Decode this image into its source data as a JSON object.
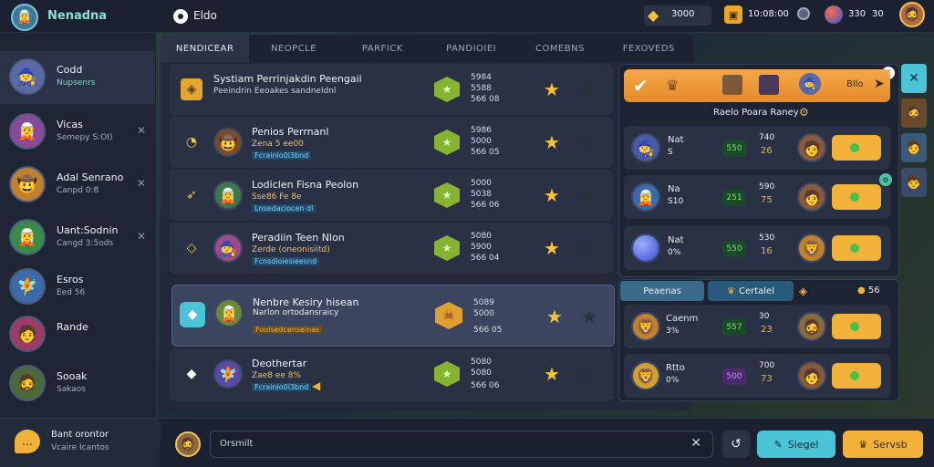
{
  "app": {
    "title": "Nenadna"
  },
  "header": {
    "page_title": "Eldo",
    "currencies": [
      {
        "icon": "gem-icon",
        "value": "3000"
      },
      {
        "icon": "coin-icon",
        "value": "10:08:00"
      },
      {
        "icon": "shield-icon",
        "value": "330"
      },
      {
        "icon": "stopwatch-icon",
        "value": "30"
      }
    ]
  },
  "tabs": [
    "NENDICEAR",
    "NEOPCLE",
    "PARFICK",
    "PANDIOIEI",
    "COMEBNS",
    "FEXOVEDS"
  ],
  "sidebar": {
    "items": [
      {
        "name": "Codd",
        "sub": "Nupsenrs"
      },
      {
        "name": "Vicas",
        "sub": "Semepy S:OI)"
      },
      {
        "name": "Adal Senrano",
        "sub": "Canpd 0:8"
      },
      {
        "name": "Uant:Sodnin",
        "sub": "Cangd 3:5ods"
      },
      {
        "name": "Esros",
        "sub": "Eed 56"
      },
      {
        "name": "Rande",
        "sub": ""
      },
      {
        "name": "Sooak",
        "sub": "Sakaos"
      }
    ],
    "footer": {
      "line1": "Bant orontor",
      "line2": "Vcaire Icantos"
    }
  },
  "rows": [
    {
      "name": "Systiam Perrinjakdin Peengaii",
      "sub": "Peeindrin Eeoakes sandneldnl",
      "tag": "",
      "stat1": "5984",
      "stat2": "5588",
      "stat3": "566 08"
    },
    {
      "name": "Penios Perrnanl",
      "sub": "Zena 5 ee00",
      "tag": "Fcrainlo0l3bnd",
      "stat1": "5986",
      "stat2": "5000",
      "stat3": "566 05"
    },
    {
      "name": "Lodiclen Fisna Peolon",
      "sub": "Sse86 Fe 8e",
      "tag": "Lnsedaciocen dl",
      "stat1": "5000",
      "stat2": "5038",
      "stat3": "566 06"
    },
    {
      "name": "Peradiin Teen Nlon",
      "sub": "Zerde (oneonisiitd)",
      "tag": "Fcnsdioiesieesnd",
      "stat1": "5080",
      "stat2": "5900",
      "stat3": "566 04"
    },
    {
      "name": "Nenbre Kesiry hisean",
      "sub": "Narlon ortodansraicy",
      "tag": "Foolsedcenseinas",
      "stat1": "5089",
      "stat2": "5000",
      "stat3": "566 05"
    },
    {
      "name": "Deothertar",
      "sub": "Zae8 ee 8%",
      "tag": "Fcrainlo0l3bnd",
      "stat1": "5080",
      "stat2": "5080",
      "stat3": "566 06"
    }
  ],
  "panel": {
    "title": "Raelo Poara Raney",
    "orange_label": "Bllo",
    "cards": [
      {
        "name": "Nat",
        "sub": "S",
        "pill": "550",
        "v1": "740",
        "v2": "26"
      },
      {
        "name": "Na",
        "sub": "S10",
        "pill": "251",
        "v1": "590",
        "v2": "75"
      },
      {
        "name": "Nat",
        "sub": "0%",
        "pill": "550",
        "v1": "530",
        "v2": "16"
      }
    ]
  },
  "panel2": {
    "tab1": "Peaenas",
    "tab2": "Certalel",
    "count": "56",
    "cards": [
      {
        "name": "Caenm",
        "sub": "3%",
        "pill": "557",
        "v1": "30",
        "v2": "23"
      },
      {
        "name": "Rtto",
        "sub": "0%",
        "pill": "500",
        "v1": "700",
        "v2": "73"
      }
    ]
  },
  "input": {
    "placeholder": "Orsmilt"
  },
  "buttons": {
    "primary": "Siegel",
    "secondary": "Servsb"
  },
  "colors": {
    "accent_gold": "#f2b23a",
    "accent_cyan": "#4cc4d8",
    "orange": "#e48a2a"
  }
}
